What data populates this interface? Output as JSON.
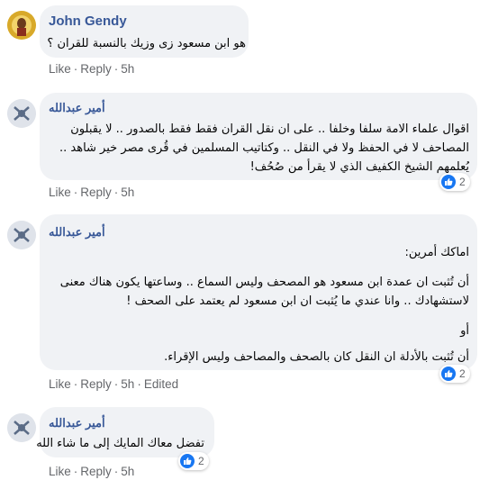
{
  "actions": {
    "like": "Like",
    "reply": "Reply",
    "dot": "·"
  },
  "comments": [
    {
      "author": "John Gendy",
      "lines": [
        "هو ابن مسعود زى وزيك بالنسبة للقران ؟"
      ],
      "time": "5h",
      "edited": ""
    },
    {
      "author": "أمير عبدالله",
      "lines": [
        "اقوال علماء الامة سلفا وخلفا .. على ان نقل القران فقط فقط بالصدور .. لا يقبلون",
        "المصاحف لا في الحفظ ولا في النقل .. وكتاتيب المسلمين في قُرى مصر خير شاهد ..",
        "يُعلمهم الشيخ الكفيف الذي لا يقرأ من صُحُف!"
      ],
      "time": "5h",
      "edited": "",
      "reactions": "2"
    },
    {
      "author": "أمير عبدالله",
      "lines": [
        "اماكك أمرين:",
        "أن تُثبت ان عمدة ابن مسعود هو المصحف وليس السماع .. وساعتها يكون هناك معنى",
        "لاستشهادك .. وانا عندي ما يُثبت ان ابن مسعود لم يعتمد على الصحف !",
        "أو",
        "أن تُثبت بالأدلة ان النقل كان بالصحف والمصاحف وليس الإقراء."
      ],
      "time": "5h",
      "edited": "Edited",
      "reactions": "2"
    },
    {
      "author": "أمير عبدالله",
      "lines": [
        "تفضل معاك المايك إلى ما شاء الله"
      ],
      "time": "5h",
      "edited": "",
      "reactions": "2"
    }
  ]
}
